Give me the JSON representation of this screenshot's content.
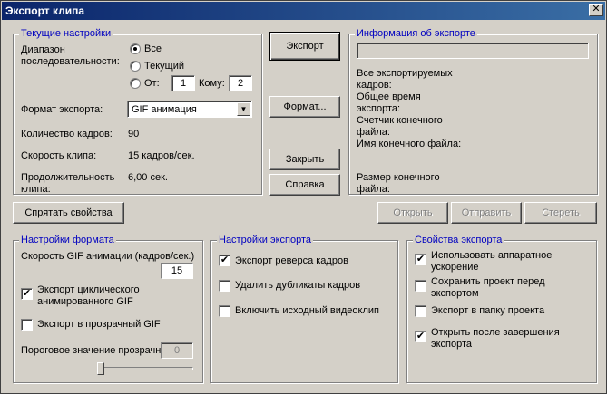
{
  "window": {
    "title": "Экспорт клипа",
    "close_glyph": "✕"
  },
  "current_settings": {
    "group_title": "Текущие настройки",
    "range_label": "Диапазон последовательности:",
    "radio_all": "Все",
    "radio_current": "Текущий",
    "radio_from": "От:",
    "from_value": "1",
    "to_label": "Кому:",
    "to_value": "2",
    "format_label": "Формат экспорта:",
    "format_value": "GIF анимация",
    "frames_label": "Количество кадров:",
    "frames_value": "90",
    "speed_label": "Скорость клипа:",
    "speed_value": "15 кадров/сек.",
    "duration_label": "Продолжительность клипа:",
    "duration_value": "6,00 сек."
  },
  "actions": {
    "export_label": "Экспорт",
    "format_label": "Формат...",
    "close_label": "Закрыть",
    "help_label": "Справка",
    "hide_props_label": "Спрятать свойства",
    "open_label": "Открыть",
    "send_label": "Отправить",
    "erase_label": "Стереть"
  },
  "export_info": {
    "group_title": "Информация об экспорте",
    "progress": 0,
    "all_frames_label": "Все экспортируемых кадров:",
    "total_time_label": "Общее время экспорта:",
    "final_counter_label": "Счетчик конечного файла:",
    "final_name_label": "Имя конечного файла:",
    "final_size_label": "Размер конечного файла:"
  },
  "format_settings": {
    "group_title": "Настройки формата",
    "gif_speed_label": "Скорость GIF анимации (кадров/сек.)",
    "gif_speed_value": "15",
    "loop_label": "Экспорт циклического анимированного GIF",
    "loop_checked": true,
    "transparent_label": "Экспорт в прозрачный GIF",
    "transparent_checked": false,
    "threshold_label": "Пороговое значение прозрачн",
    "threshold_value": "0",
    "threshold_level": 0
  },
  "export_settings": {
    "group_title": "Настройки экспорта",
    "reverse_label": "Экспорт реверса кадров",
    "reverse_checked": true,
    "dedupe_label": "Удалить дубликаты кадров",
    "dedupe_checked": false,
    "include_source_label": "Включить исходный видеоклип",
    "include_source_checked": false
  },
  "export_props": {
    "group_title": "Свойства экспорта",
    "hw_accel_label": "Использовать аппаратное ускорение",
    "hw_accel_checked": true,
    "save_project_label": "Сохранить проект перед экспортом",
    "save_project_checked": false,
    "export_to_folder_label": "Экспорт в папку проекта",
    "export_to_folder_checked": false,
    "open_after_label": "Открыть после завершения экспорта",
    "open_after_checked": true
  },
  "colors": {
    "title_start": "#0a246a",
    "title_end": "#3a6ea5",
    "group_title": "#0000c0",
    "face": "#d4d0c8"
  }
}
